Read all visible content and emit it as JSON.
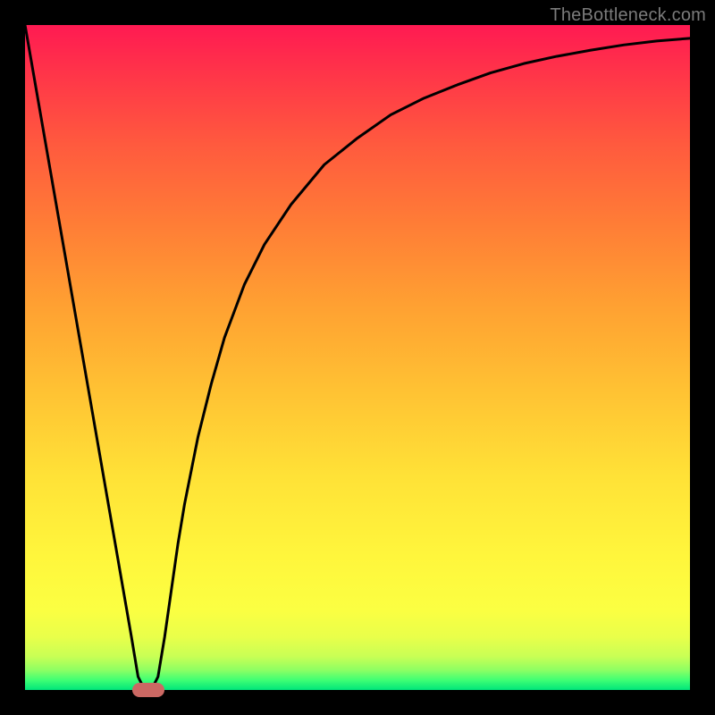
{
  "watermark": "TheBottleneck.com",
  "chart_data": {
    "type": "line",
    "title": "",
    "xlabel": "",
    "ylabel": "",
    "xlim": [
      0,
      100
    ],
    "ylim": [
      0,
      100
    ],
    "x": [
      0,
      2,
      4,
      6,
      8,
      10,
      12,
      14,
      16,
      17,
      18,
      19,
      20,
      21,
      22,
      23,
      24,
      26,
      28,
      30,
      33,
      36,
      40,
      45,
      50,
      55,
      60,
      65,
      70,
      75,
      80,
      85,
      90,
      95,
      100
    ],
    "y": [
      100,
      88.5,
      77,
      65.5,
      54,
      42.5,
      31,
      19.5,
      8,
      2,
      0,
      0,
      2,
      8,
      15,
      22,
      28,
      38,
      46,
      53,
      61,
      67,
      73,
      79,
      83,
      86.5,
      89,
      91,
      92.8,
      94.2,
      95.3,
      96.2,
      97,
      97.6,
      98
    ],
    "marker": {
      "x": 18.5,
      "y": 0
    },
    "background_gradient": {
      "top": "#ff1a52",
      "mid": "#ffe237",
      "bottom": "#00e57a"
    },
    "notes": "V-shaped bottleneck curve; minimum near x≈18–19, y=0. Values estimated from pixels; no axis ticks or labels are shown."
  }
}
